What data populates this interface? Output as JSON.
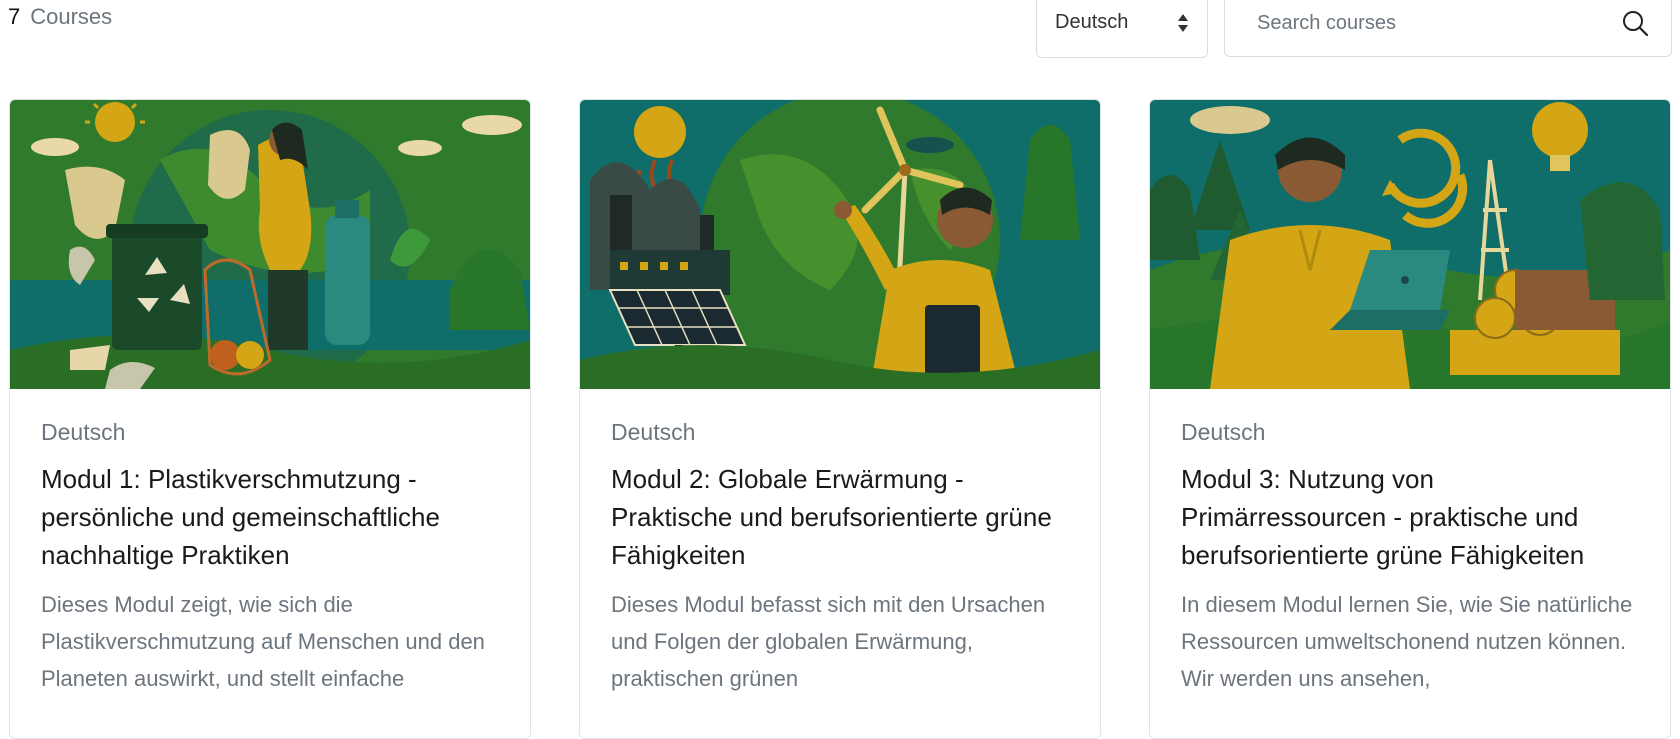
{
  "header": {
    "course_count": "7",
    "course_count_label": "Courses",
    "language_select": {
      "selected": "Deutsch"
    },
    "search": {
      "placeholder": "Search courses",
      "value": ""
    }
  },
  "courses": [
    {
      "language": "Deutsch",
      "title": "Modul 1: Plastikverschmutzung - persönliche und gemeinschaftliche nachhaltige Praktiken",
      "description": "Dieses Modul zeigt, wie sich die Plastikverschmutzung auf Menschen und den Planeten auswirkt, und stellt einfache"
    },
    {
      "language": "Deutsch",
      "title": "Modul 2: Globale Erwärmung - Praktische und berufsorientierte grüne Fähigkeiten",
      "description": "Dieses Modul befasst sich mit den Ursachen und Folgen der globalen Erwärmung, praktischen grünen"
    },
    {
      "language": "Deutsch",
      "title": "Modul 3: Nutzung von Primärressourcen - praktische und berufsorientierte grüne Fähigkeiten",
      "description": "In diesem Modul lernen Sie, wie Sie natürliche Ressourcen umweltschonend nutzen können. Wir werden uns ansehen,"
    }
  ],
  "icons": {
    "search": "search-icon",
    "select_arrows": "sort-arrows-icon"
  },
  "colors": {
    "illustration_green": "#2f7a2c",
    "illustration_teal": "#0f6e69",
    "illustration_gold": "#d4a514",
    "muted_text": "#6c757d",
    "border": "#dfe3e7"
  }
}
